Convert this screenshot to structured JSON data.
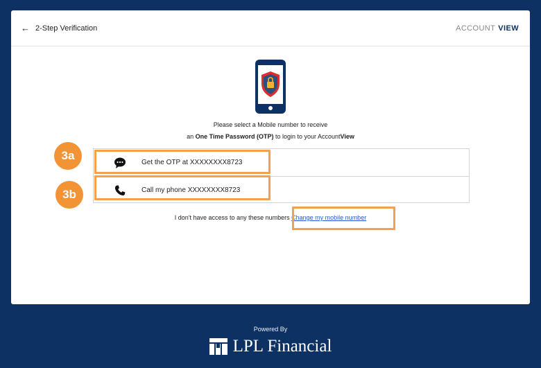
{
  "header": {
    "back_label": "2-Step Verification",
    "brand_light": "ACCOUNT",
    "brand_bold": "VIEW"
  },
  "instructions": {
    "line1": "Please select a Mobile number to receive",
    "line2_prefix": "an ",
    "line2_bold": "One Time Password (OTP)",
    "line2_middle": " to login to your Account",
    "line2_brand": "View"
  },
  "options": [
    {
      "label": "Get the OTP at XXXXXXXX8723",
      "icon": "chat-bubble-icon"
    },
    {
      "label": "Call my phone XXXXXXXX8723",
      "icon": "phone-icon"
    }
  ],
  "callouts": {
    "a": "3a",
    "b": "3b"
  },
  "access": {
    "text": "I don't have access to any these numbers",
    "link": "Change my mobile number"
  },
  "footer": {
    "powered_by": "Powered By",
    "company": "LPL Financial"
  },
  "colors": {
    "background": "#0d3162",
    "highlight": "#f5a04e",
    "badge": "#f29436",
    "link": "#2a55d8"
  }
}
